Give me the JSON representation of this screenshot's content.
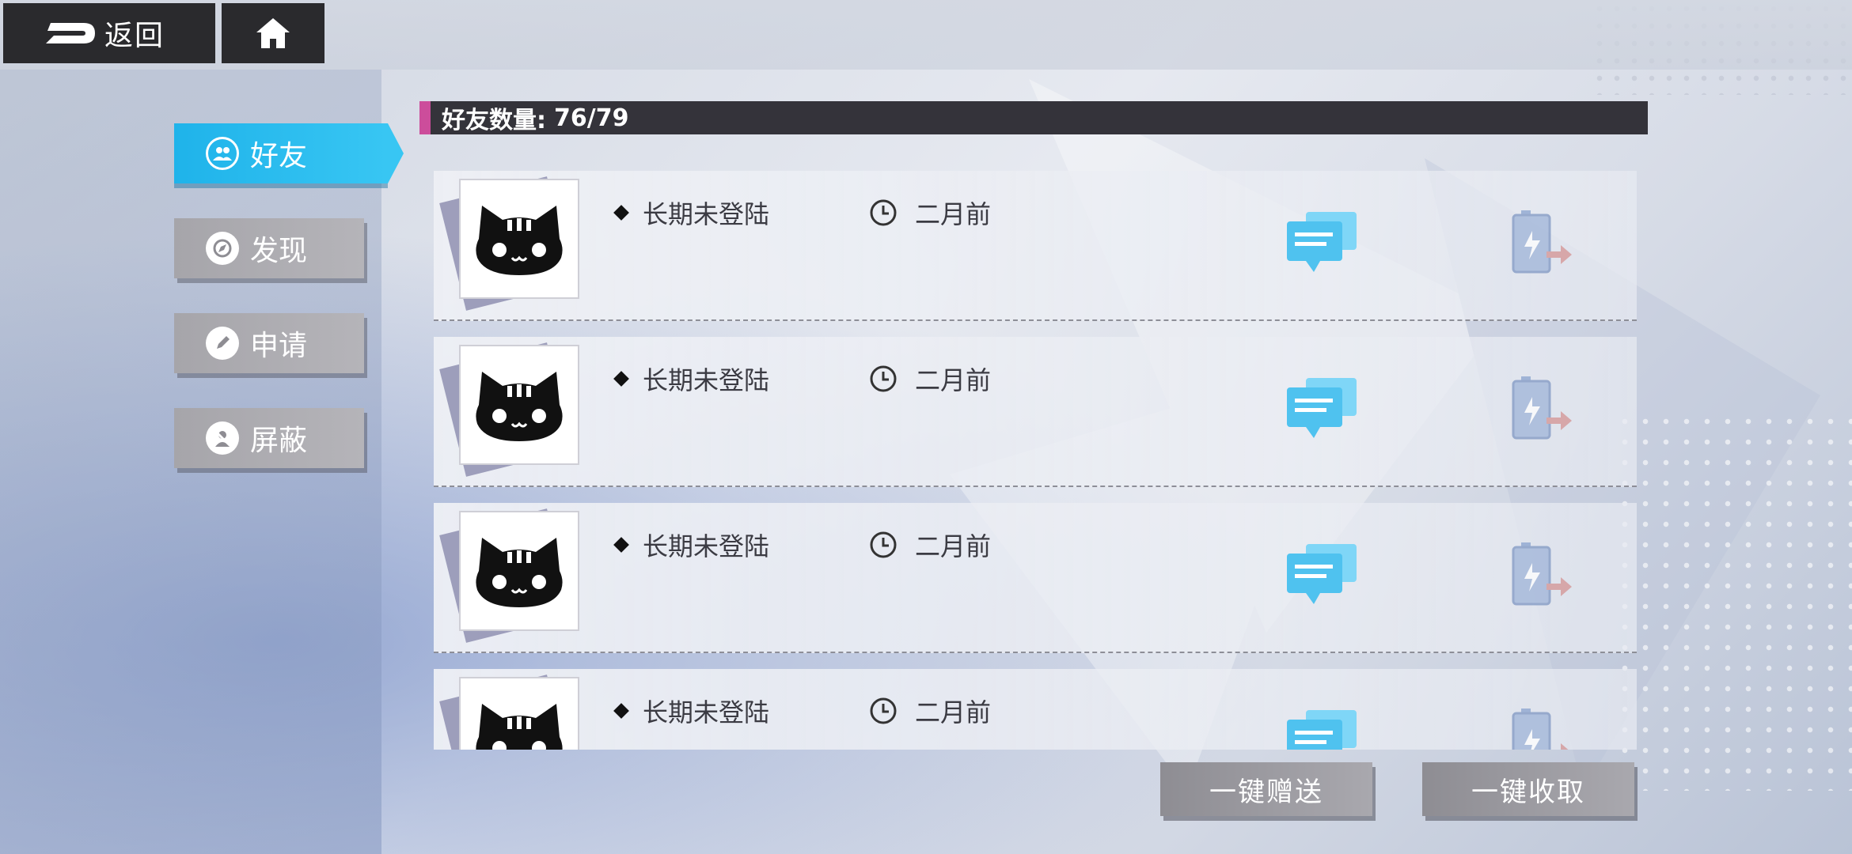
{
  "topbar": {
    "back_label": "返回"
  },
  "sidebar": {
    "items": [
      {
        "label": "好友",
        "icon": "friends-icon",
        "active": true
      },
      {
        "label": "发现",
        "icon": "discover-icon",
        "active": false
      },
      {
        "label": "申请",
        "icon": "apply-icon",
        "active": false
      },
      {
        "label": "屏蔽",
        "icon": "block-icon",
        "active": false
      }
    ]
  },
  "friends": {
    "count_label": "好友数量:",
    "count_value": "76/79",
    "rows": [
      {
        "status": "长期未登陆",
        "last_seen": "二月前"
      },
      {
        "status": "长期未登陆",
        "last_seen": "二月前"
      },
      {
        "status": "长期未登陆",
        "last_seen": "二月前"
      },
      {
        "status": "长期未登陆",
        "last_seen": "二月前"
      }
    ]
  },
  "actions": {
    "send_all": "一键赠送",
    "receive_all": "一键收取"
  },
  "colors": {
    "accent_blue": "#1fb3ea",
    "accent_pink": "#cc4d9b",
    "header_dark": "#34333a",
    "button_gray": "#a6a5aa"
  }
}
